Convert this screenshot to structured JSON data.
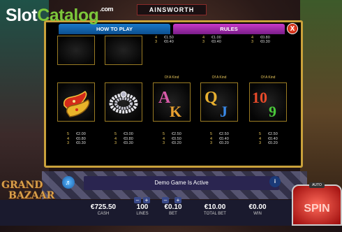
{
  "watermark": {
    "slot": "Slot",
    "catalog": "Catalog",
    "com": ".com"
  },
  "brand": "AINSWORTH",
  "tabs": {
    "how_to_play": "HOW TO PLAY",
    "rules": "RULES",
    "close": "X"
  },
  "top_row": [
    {
      "lines": []
    },
    {
      "lines": []
    },
    {
      "lines": [
        {
          "n": "4",
          "v": "€1.50"
        },
        {
          "n": "3",
          "v": "€0.40"
        }
      ]
    },
    {
      "lines": [
        {
          "n": "4",
          "v": "€1.00"
        },
        {
          "n": "3",
          "v": "€0.40"
        }
      ]
    },
    {
      "lines": [
        {
          "n": "4",
          "v": "€0.80"
        },
        {
          "n": "3",
          "v": "€0.30"
        }
      ]
    }
  ],
  "symbols": [
    {
      "name": "slippers",
      "of_a_kind": "",
      "pays": [
        {
          "n": "5",
          "v": "€2.00"
        },
        {
          "n": "4",
          "v": "€0.80"
        },
        {
          "n": "3",
          "v": "€0.30"
        }
      ]
    },
    {
      "name": "pearls",
      "of_a_kind": "",
      "pays": [
        {
          "n": "5",
          "v": "€3.00"
        },
        {
          "n": "4",
          "v": "€0.80"
        },
        {
          "n": "3",
          "v": "€0.30"
        }
      ]
    },
    {
      "name": "ace-king",
      "of_a_kind": "Of A Kind",
      "pays": [
        {
          "n": "5",
          "v": "€2.50"
        },
        {
          "n": "4",
          "v": "€0.50"
        },
        {
          "n": "3",
          "v": "€0.20"
        }
      ]
    },
    {
      "name": "queen-jack",
      "of_a_kind": "Of A Kind",
      "pays": [
        {
          "n": "5",
          "v": "€2.50"
        },
        {
          "n": "4",
          "v": "€0.40"
        },
        {
          "n": "3",
          "v": "€0.20"
        }
      ]
    },
    {
      "name": "ten-nine",
      "of_a_kind": "Of A Kind",
      "pays": [
        {
          "n": "5",
          "v": "€2.50"
        },
        {
          "n": "4",
          "v": "€0.40"
        },
        {
          "n": "3",
          "v": "€0.20"
        }
      ]
    }
  ],
  "symbol_letters": {
    "a": "A",
    "k": "K",
    "q": "Q",
    "j": "J",
    "ten": "10",
    "nine": "9"
  },
  "info": {
    "message": "Demo Game Is Active",
    "info_icon": "i"
  },
  "stats": {
    "cash": {
      "value": "€725.50",
      "label": "CASH"
    },
    "lines": {
      "value": "100",
      "label": "LINES"
    },
    "bet": {
      "value": "€0.10",
      "label": "BET"
    },
    "total_bet": {
      "value": "€10.00",
      "label": "TOTAL BET"
    },
    "win": {
      "value": "€0.00",
      "label": "WIN"
    }
  },
  "controls": {
    "minus": "–",
    "plus": "+",
    "spin": "SPIN",
    "auto": "AUTO"
  },
  "logo": {
    "line1": "GRAND",
    "line2": "BAZAAR"
  }
}
